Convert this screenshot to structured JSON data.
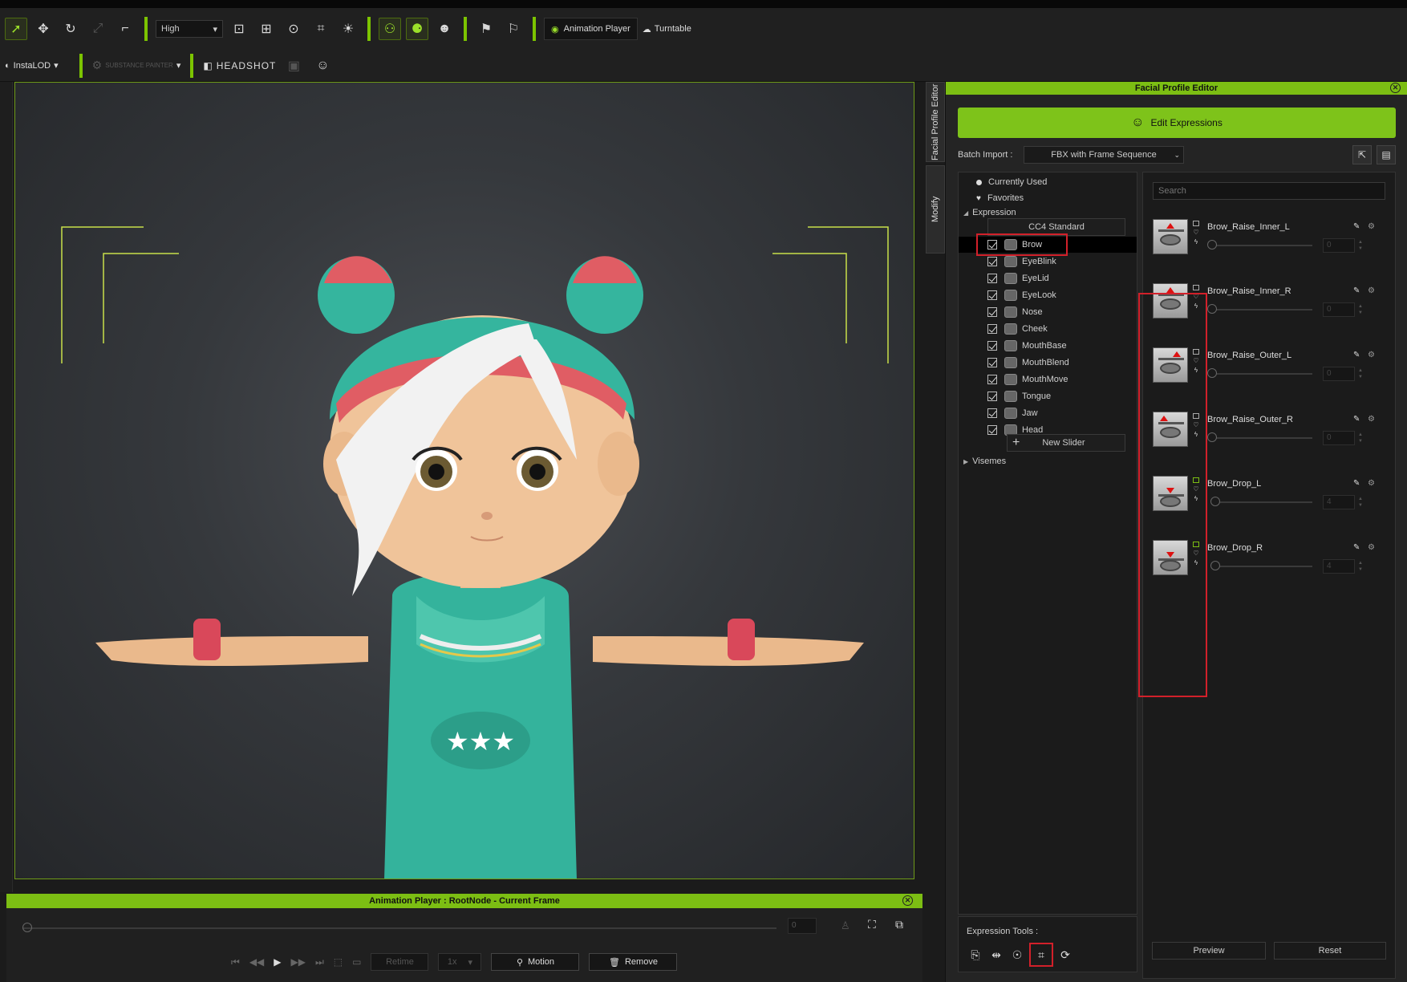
{
  "toolbar": {
    "quality_value": "High",
    "animation_player_label": "Animation Player",
    "turntable_label": "Turntable",
    "instalod_label": "InstaLOD",
    "substance_label": "SUBSTANCE PAINTER",
    "headshot_label": "HEADSHOT"
  },
  "side_tabs": {
    "facial_profile_editor": "Facial Profile Editor",
    "modify": "Modify"
  },
  "fpe": {
    "title": "Facial Profile Editor",
    "edit_expressions": "Edit Expressions",
    "batch_import_label": "Batch Import :",
    "batch_import_value": "FBX with Frame Sequence",
    "tree": {
      "currently_used": "Currently Used",
      "favorites": "Favorites",
      "expression": "Expression",
      "cc4_standard": "CC4 Standard",
      "categories": [
        "Brow",
        "EyeBlink",
        "EyeLid",
        "EyeLook",
        "Nose",
        "Cheek",
        "MouthBase",
        "MouthBlend",
        "MouthMove",
        "Tongue",
        "Jaw",
        "Head"
      ],
      "new_slider": "New Slider",
      "visemes": "Visemes"
    },
    "search_placeholder": "Search",
    "sliders": [
      {
        "name": "Brow_Raise_Inner_L",
        "value": "0",
        "dir": "up"
      },
      {
        "name": "Brow_Raise_Inner_R",
        "value": "0",
        "dir": "up"
      },
      {
        "name": "Brow_Raise_Outer_L",
        "value": "0",
        "dir": "up"
      },
      {
        "name": "Brow_Raise_Outer_R",
        "value": "0",
        "dir": "up"
      },
      {
        "name": "Brow_Drop_L",
        "value": "4",
        "dir": "down"
      },
      {
        "name": "Brow_Drop_R",
        "value": "4",
        "dir": "down"
      }
    ],
    "expression_tools_label": "Expression Tools :",
    "preview_label": "Preview",
    "reset_label": "Reset"
  },
  "anim": {
    "title": "Animation Player : RootNode - Current Frame",
    "frame_value": "0",
    "retime_label": "Retime",
    "speed_value": "1x",
    "motion_label": "Motion",
    "remove_label": "Remove"
  },
  "colors": {
    "accent_green": "#7cbe13",
    "highlight_red": "#d2202a"
  }
}
